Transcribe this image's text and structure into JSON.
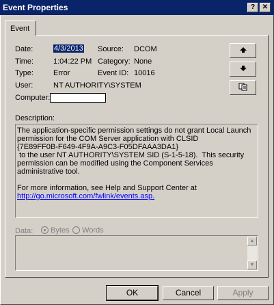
{
  "window": {
    "title": "Event Properties",
    "help_btn": "?",
    "close_btn": "✕"
  },
  "tabs": [
    {
      "label": "Event"
    }
  ],
  "event": {
    "date_label": "Date:",
    "date_value": "4/3/2013",
    "time_label": "Time:",
    "time_value": "1:04:22 PM",
    "type_label": "Type:",
    "type_value": "Error",
    "user_label": "User:",
    "user_value": "NT AUTHORITY\\SYSTEM",
    "computer_label": "Computer:",
    "computer_value": "",
    "source_label": "Source:",
    "source_value": "DCOM",
    "category_label": "Category:",
    "category_value": "None",
    "event_id_label": "Event ID:",
    "event_id_value": "10016"
  },
  "side_buttons": {
    "up_icon": "up-arrow-icon",
    "down_icon": "down-arrow-icon",
    "copy_icon": "copy-icon"
  },
  "description": {
    "label": "Description:",
    "text": "The application-specific permission settings do not grant Local Launch permission for the COM Server application with CLSID\n{7E89FF0B-F649-4F9A-A9C3-F05DFAAA3DA1}\n to the user NT AUTHORITY\\SYSTEM SID (S-1-5-18).  This security permission can be modified using the Component Services administrative tool.\n\nFor more information, see Help and Support Center at\n",
    "link": "http://go.microsoft.com/fwlink/events.asp."
  },
  "data_section": {
    "label": "Data:",
    "bytes_label": "Bytes",
    "words_label": "Words",
    "selected": "Bytes"
  },
  "buttons": {
    "ok": "OK",
    "cancel": "Cancel",
    "apply": "Apply"
  }
}
